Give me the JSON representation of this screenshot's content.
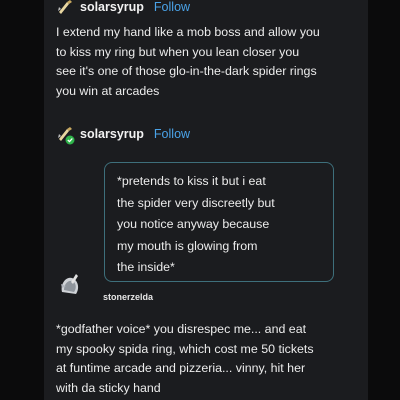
{
  "post1": {
    "username": "solarsyrup",
    "follow_label": "Follow",
    "lines": [
      "I extend my hand like a mob boss and allow you",
      "to kiss my ring but when you lean closer you",
      "see it's one of those glo-in-the-dark spider rings",
      "you win at arcades"
    ]
  },
  "post2": {
    "username": "solarsyrup",
    "follow_label": "Follow",
    "quote_lines": [
      "*pretends to kiss it but i eat",
      "the spider very discreetly but",
      "you notice anyway because",
      "my mouth is glowing from",
      "the inside*"
    ]
  },
  "post3": {
    "username": "stonerzelda",
    "lines": [
      "*godfather voice* you disrespec me... and eat",
      "my spooky spida ring, which cost me 50 tickets",
      "at funtime arcade and pizzeria... vinny, hit her",
      "with da sticky hand"
    ]
  },
  "colors": {
    "background": "#1b1c1f",
    "text": "#ececec",
    "follow": "#4aa3e8",
    "quote_border": "#3e6f7b"
  }
}
